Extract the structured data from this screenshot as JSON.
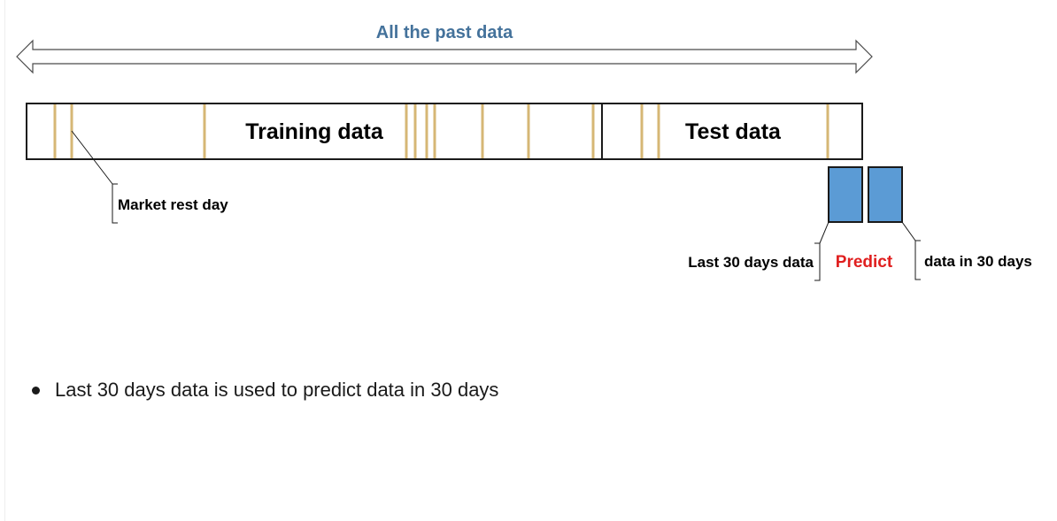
{
  "arrow": {
    "label": "All the past data",
    "color": "#44729b"
  },
  "timeline": {
    "training_label": "Training data",
    "test_label": "Test data",
    "rest_day_color": "#d6b775",
    "rest_day_label": "Market rest day"
  },
  "prediction": {
    "input_label": "Last 30 days data",
    "action_label": "Predict",
    "action_color": "#e01f1f",
    "output_label": "data in 30 days",
    "box_fill": "#5b9bd5",
    "box_stroke": "#1a1a1a"
  },
  "bullets": [
    "Last 30 days data is used to predict data in 30 days"
  ]
}
